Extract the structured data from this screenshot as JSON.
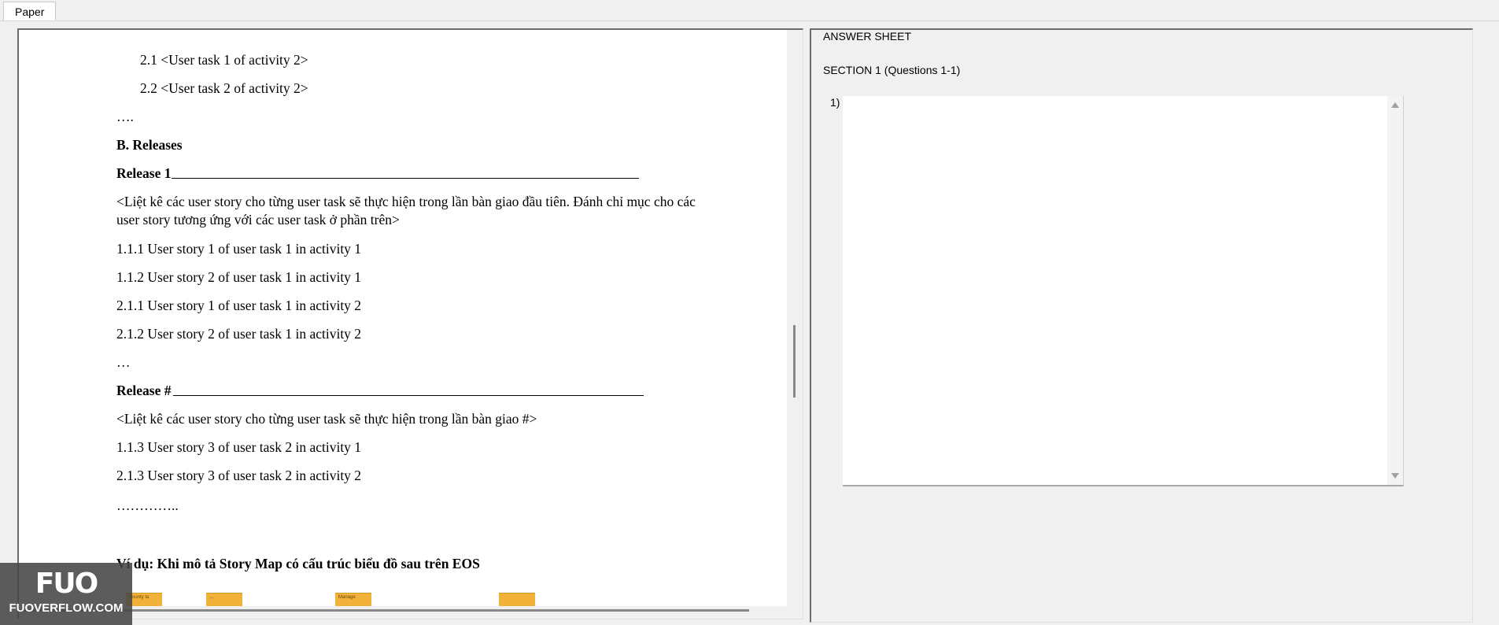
{
  "tab": {
    "label": "Paper"
  },
  "doc": {
    "lines": [
      "2.1 <User task 1 of activity 2>",
      "2.2 <User task 2 of activity 2>",
      "….",
      "B. Releases",
      "Release 1",
      "<Liệt kê các user story cho từng user task sẽ thực hiện trong lần bàn giao đầu tiên. Đánh chỉ mục cho các",
      "user story tương ứng với các user task ở phần trên>",
      "1.1.1 User story 1 of user task 1 in activity 1",
      "1.1.2 User story 2 of user task 1 in activity 1",
      "2.1.1 User story 1 of user task 1 in activity 2",
      "2.1.2 User story 2 of user task 1 in activity 2",
      "…",
      "Release #",
      "<Liệt kê các user story cho từng user task sẽ thực hiện trong lần bàn giao #>",
      "1.1.3 User story 3 of user task 2 in activity 1",
      "2.1.3 User story 3 of user task 2 in activity 2",
      "…………..",
      "Ví dụ: Khi mô tả Story Map có cấu trúc biểu đồ sau trên EOS"
    ],
    "stickies": [
      "Bounty ta",
      "…",
      "Manage",
      ""
    ]
  },
  "answer": {
    "title": "ANSWER SHEET",
    "section": "SECTION 1 (Questions 1-1)",
    "question_label": "1)",
    "value": ""
  },
  "watermark": {
    "logo": "FUO",
    "text": "FUOVERFLOW.COM"
  }
}
